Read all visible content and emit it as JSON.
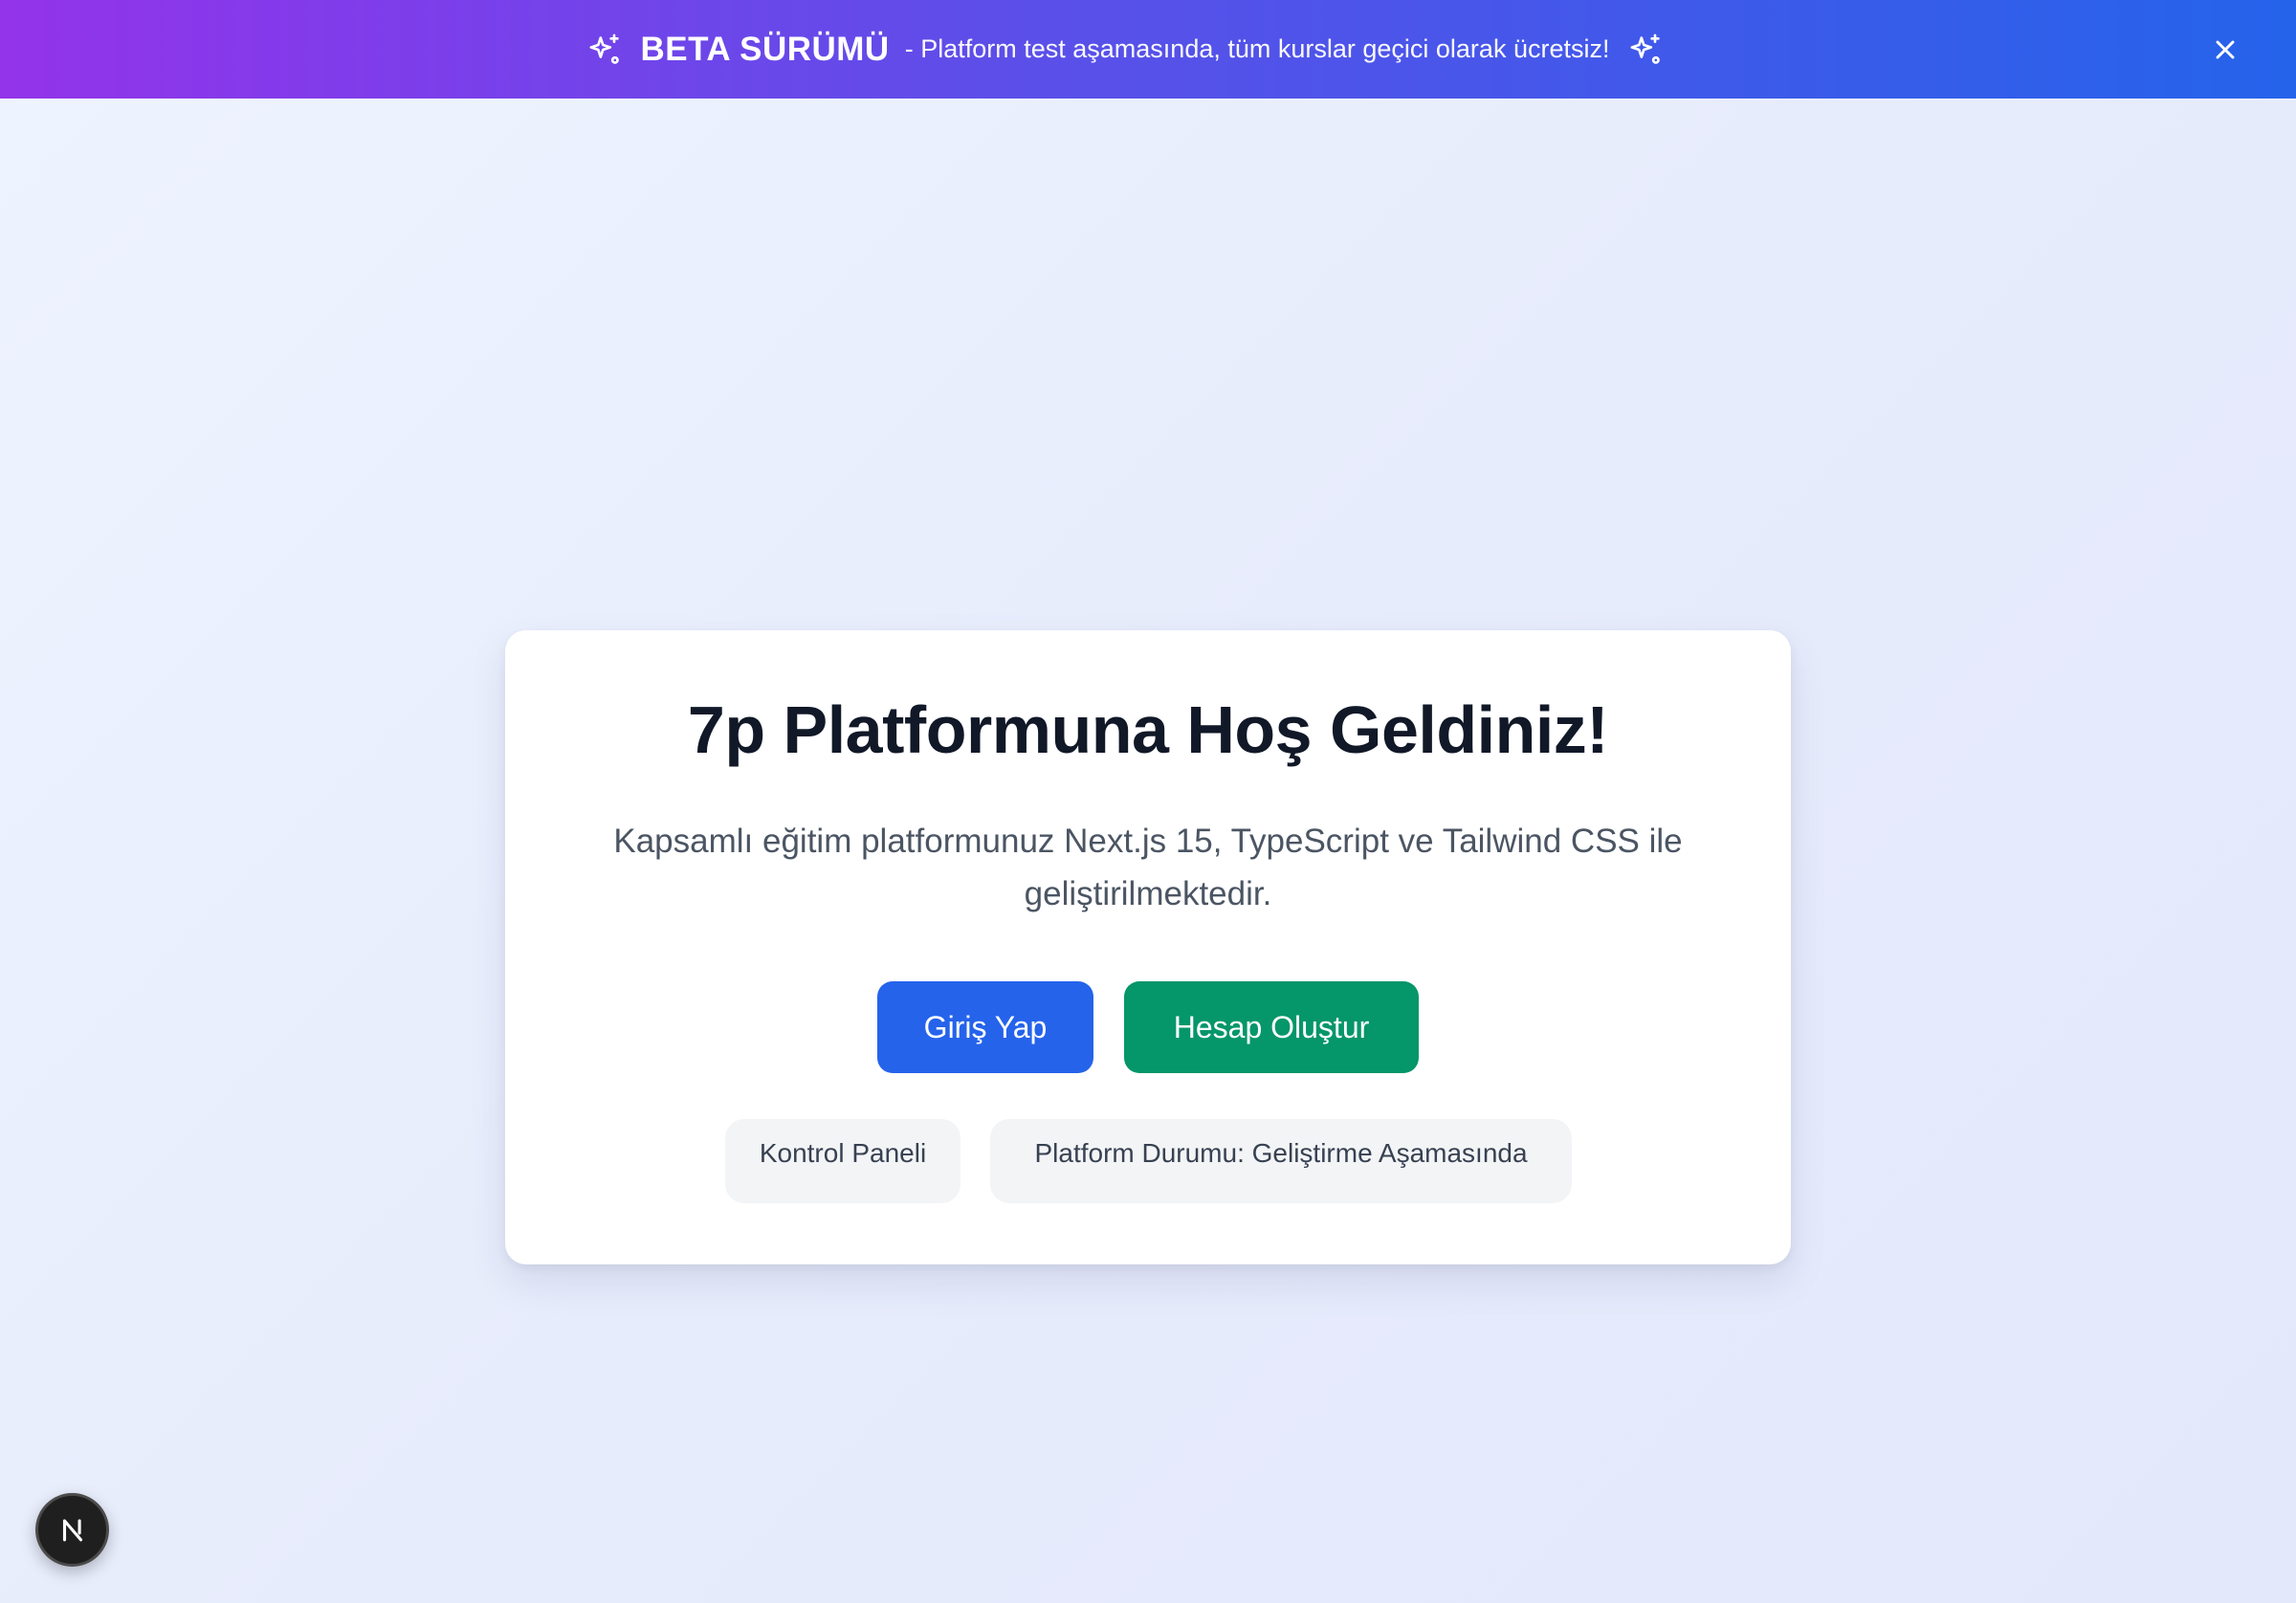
{
  "banner": {
    "title": "BETA SÜRÜMÜ",
    "message": "- Platform test aşamasında, tüm kurslar geçici olarak ücretsiz!",
    "left_icon": "sparkles-icon",
    "right_icon": "sparkles-icon",
    "close_icon": "close-icon",
    "gradient_start": "#9333ea",
    "gradient_end": "#2563eb"
  },
  "card": {
    "title": "7p Platformuna Hoş Geldiniz!",
    "description": "Kapsamlı eğitim platformunuz Next.js 15, TypeScript ve Tailwind CSS ile geliştirilmektedir.",
    "login_label": "Giriş Yap",
    "register_label": "Hesap Oluştur",
    "dashboard_label": "Kontrol Paneli",
    "status_label": "Platform Durumu: Geliştirme Aşamasında"
  },
  "colors": {
    "login_button": "#2563eb",
    "register_button": "#059669",
    "chip_background": "#f3f4f6"
  },
  "dev_badge": {
    "letter": "N",
    "icon": "nextjs-icon"
  }
}
